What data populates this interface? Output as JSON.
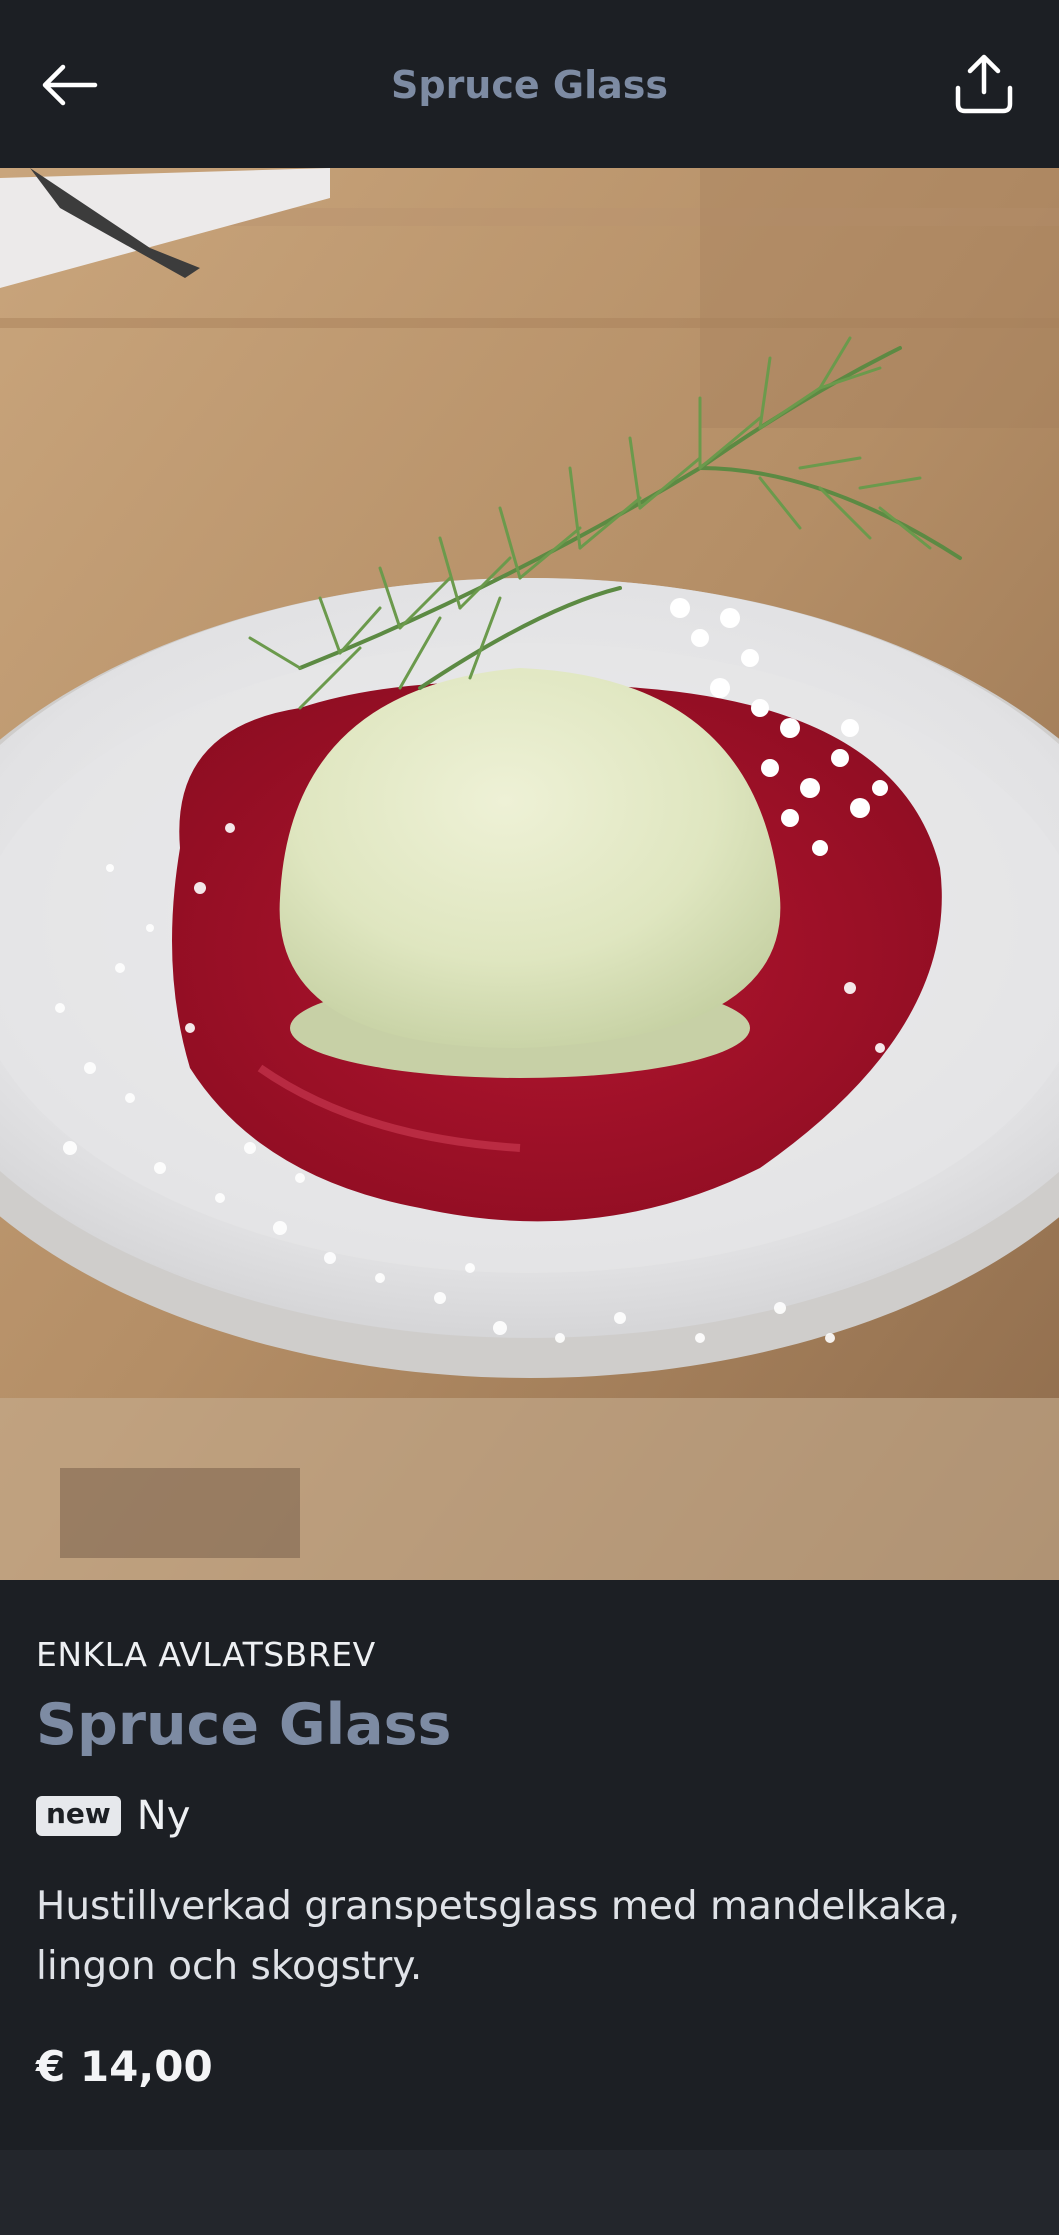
{
  "header": {
    "title": "Spruce Glass",
    "back_icon": "arrow-left-icon",
    "share_icon": "share-upload-icon"
  },
  "hero": {
    "alt": "Spruce Glass"
  },
  "product": {
    "category": "ENKLA AVLATSBREV",
    "title": "Spruce Glass",
    "badge": "new",
    "badge_label": "Ny",
    "description": "Hustillverkad granspetsglass med mandelkaka, lingon och skogstry.",
    "price": "€ 14,00"
  },
  "colors": {
    "background": "#1c1f24",
    "accent": "#7d8ba3",
    "text": "#eef0f3"
  }
}
